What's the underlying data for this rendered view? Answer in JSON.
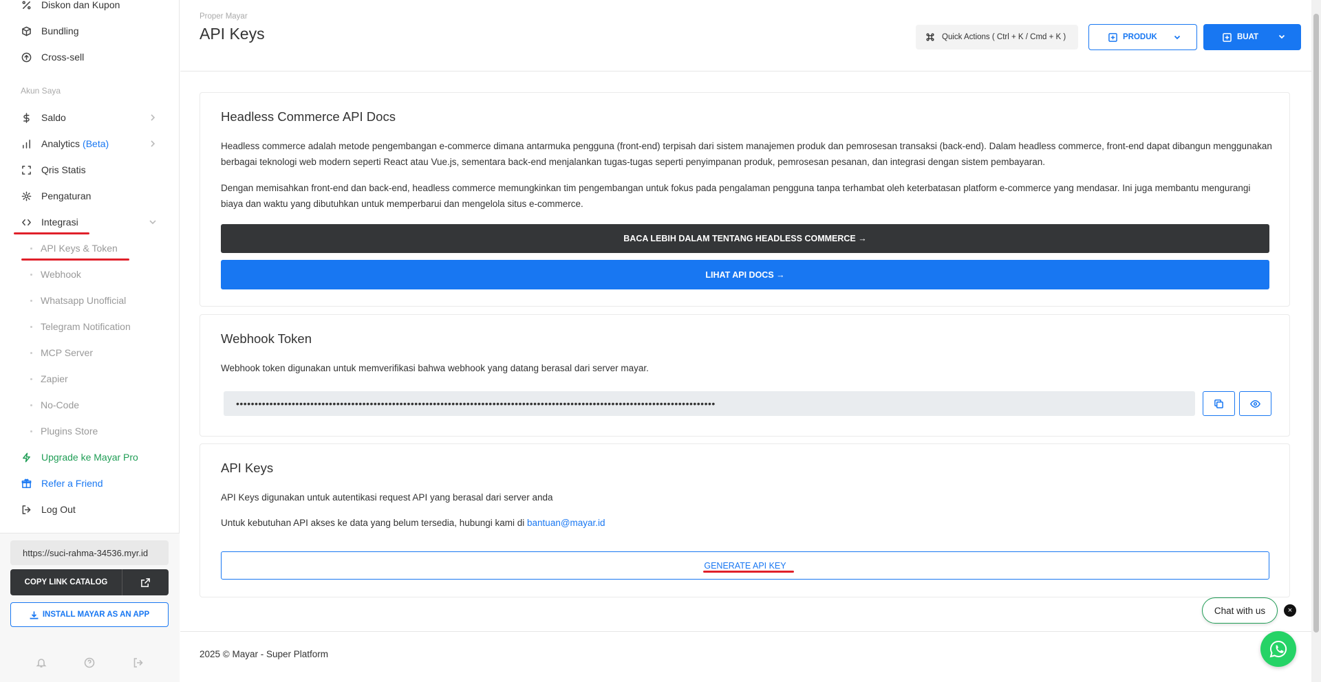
{
  "sidebar": {
    "top_items": [
      {
        "label": "Diskon dan Kupon",
        "icon": "percent-icon"
      },
      {
        "label": "Bundling",
        "icon": "box-icon"
      },
      {
        "label": "Cross-sell",
        "icon": "arrow-up-circle-icon"
      }
    ],
    "section_label": "Akun Saya",
    "account_items": [
      {
        "label": "Saldo",
        "icon": "dollar-icon"
      },
      {
        "label": "Analytics",
        "badge": "(Beta)",
        "icon": "bar-chart-icon"
      },
      {
        "label": "Qris Statis",
        "icon": "scan-icon"
      },
      {
        "label": "Pengaturan",
        "icon": "gear-icon"
      },
      {
        "label": "Integrasi",
        "icon": "code-icon"
      }
    ],
    "sub_items": [
      "API Keys & Token",
      "Webhook",
      "Whatsapp Unofficial",
      "Telegram Notification",
      "MCP Server",
      "Zapier",
      "No-Code",
      "Plugins Store"
    ],
    "extra_items": [
      {
        "label": "Upgrade ke Mayar Pro",
        "icon": "zap-icon"
      },
      {
        "label": "Refer a Friend",
        "icon": "gift-icon"
      },
      {
        "label": "Log Out",
        "icon": "logout-icon"
      }
    ],
    "store_url": "https://suci-rahma-34536.myr.id",
    "copy_link_label": "COPY LINK CATALOG",
    "install_label": "INSTALL MAYAR AS AN APP"
  },
  "header": {
    "breadcrumb": "Proper Mayar",
    "title": "API Keys",
    "quick_actions": "Quick Actions ( Ctrl + K / Cmd + K )",
    "produk_label": "PRODUK",
    "buat_label": "BUAT"
  },
  "docs_card": {
    "title": "Headless Commerce API Docs",
    "para1": "Headless commerce adalah metode pengembangan e-commerce dimana antarmuka pengguna (front-end) terpisah dari sistem manajemen produk dan pemrosesan transaksi (back-end). Dalam headless commerce, front-end dapat dibangun menggunakan berbagai teknologi web modern seperti React atau Vue.js, sementara back-end menjalankan tugas-tugas seperti penyimpanan produk, pemrosesan pesanan, dan integrasi dengan sistem pembayaran.",
    "para2": "Dengan memisahkan front-end dan back-end, headless commerce memungkinkan tim pengembangan untuk fokus pada pengalaman pengguna tanpa terhambat oleh keterbatasan platform e-commerce yang mendasar. Ini juga membantu mengurangi biaya dan waktu yang dibutuhkan untuk memperbarui dan mengelola situs e-commerce.",
    "read_more_label": "BACA LEBIH DALAM TENTANG HEADLESS COMMERCE →",
    "api_docs_label": "LIHAT API DOCS →"
  },
  "webhook_card": {
    "title": "Webhook Token",
    "description": "Webhook token digunakan untuk memverifikasi bahwa webhook yang datang berasal dari server mayar.",
    "token_masked": "•••••••••••••••••••••••••••••••••••••••••••••••••••••••••••••••••••••••••••••••••••••••••••••••••••••••••••••••••••••••••••••••••"
  },
  "api_card": {
    "title": "API Keys",
    "description": "API Keys digunakan untuk autentikasi request API yang berasal dari server anda",
    "contact_prefix": "Untuk kebutuhan API akses ke data yang belum tersedia, hubungi kami di ",
    "contact_email": "bantuan@mayar.id",
    "generate_label": "GENERATE API KEY"
  },
  "footer": {
    "copyright": "2025 © Mayar - Super Platform"
  },
  "chat": {
    "label": "Chat with us",
    "close": "×"
  },
  "colors": {
    "accent": "#1877f2",
    "dark": "#343638",
    "green": "#1f9d55",
    "annotation_red": "#e0202a"
  }
}
